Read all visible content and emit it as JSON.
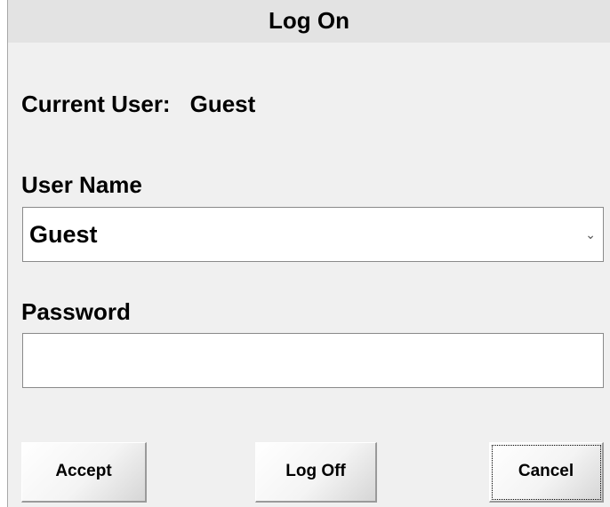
{
  "dialog": {
    "title": "Log On"
  },
  "current_user": {
    "label": "Current User:",
    "value": "Guest"
  },
  "username": {
    "label": "User Name",
    "selected": "Guest"
  },
  "password": {
    "label": "Password",
    "value": ""
  },
  "buttons": {
    "accept": "Accept",
    "log_off": "Log Off",
    "cancel": "Cancel"
  },
  "icons": {
    "dropdown": "chevron-down-icon"
  }
}
